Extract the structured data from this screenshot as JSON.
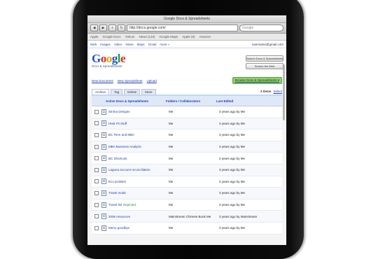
{
  "browser": {
    "title": "Google Docs & Spreadsheets",
    "url": "http://docs.google.com/",
    "search_placeholder": "Google",
    "bookmarks": [
      "Apple",
      "Google Docs",
      "Yahoo!",
      "News (133)",
      "Google Maps",
      "Apple (5)",
      "Amazon"
    ]
  },
  "gbar": {
    "links": [
      "Web",
      "Images",
      "Video",
      "News",
      "Maps",
      "Gmail",
      "more »"
    ],
    "account": "username@gmail.com"
  },
  "header": {
    "logo": [
      "G",
      "o",
      "o",
      "g",
      "l",
      "e"
    ],
    "logo_sub": "Docs & Spreadsheets",
    "search_docs": "Search Docs & Spreadsheets",
    "search_web": "Search the Web"
  },
  "actions": {
    "new_document": "New Document",
    "new_spreadsheet": "New Spreadsheet",
    "upload": "Upload",
    "share_button": "Browse Docs & Spreadsheets ▾"
  },
  "tabs": [
    "Archive",
    "Tag",
    "Delete",
    "More"
  ],
  "tabs_right": {
    "label": "3 Items",
    "link": "Select"
  },
  "columns": {
    "name": "Active Docs & Spreadsheets",
    "folder": "Folders / Collaborators",
    "date": "Last Edited"
  },
  "rows": [
    {
      "name": "Strima Designs",
      "tag": "",
      "folder": "Me",
      "sub": "",
      "date": "3 years ago by Me"
    },
    {
      "name": "Heat Fit Stuff",
      "tag": "",
      "folder": "Me",
      "sub": "",
      "date": "3 years ago by Me"
    },
    {
      "name": "BC Term and MBA",
      "tag": "",
      "folder": "Me",
      "sub": "",
      "date": "3 years ago by Me"
    },
    {
      "name": "MBA Business Analysis",
      "tag": "",
      "folder": "Me",
      "sub": "",
      "date": "3 years ago by Me"
    },
    {
      "name": "BC Shortcuts",
      "tag": "",
      "folder": "Me",
      "sub": "",
      "date": "3 years ago by Me"
    },
    {
      "name": "Laguna account reconciliation",
      "tag": "",
      "folder": "Me",
      "sub": "",
      "date": "3 years ago by Me"
    },
    {
      "name": "Eco problem",
      "tag": "",
      "folder": "Me",
      "sub": "",
      "date": "3 years ago by Me"
    },
    {
      "name": "Travel mode",
      "tag": "",
      "folder": "Me",
      "sub": "",
      "date": "3 years ago by Me"
    },
    {
      "name": "Travel list",
      "tag": "Rejected",
      "folder": "Me",
      "sub": "",
      "date": "3 years ago by Me"
    },
    {
      "name": "2006 resources",
      "tag": "",
      "folder": "Mainstream Chinese Book Me",
      "sub": "",
      "date": "3 years ago by Mainstream"
    },
    {
      "name": "Merry goodbye",
      "tag": "",
      "folder": "Me",
      "sub": "",
      "date": "3 years ago by Me"
    }
  ]
}
